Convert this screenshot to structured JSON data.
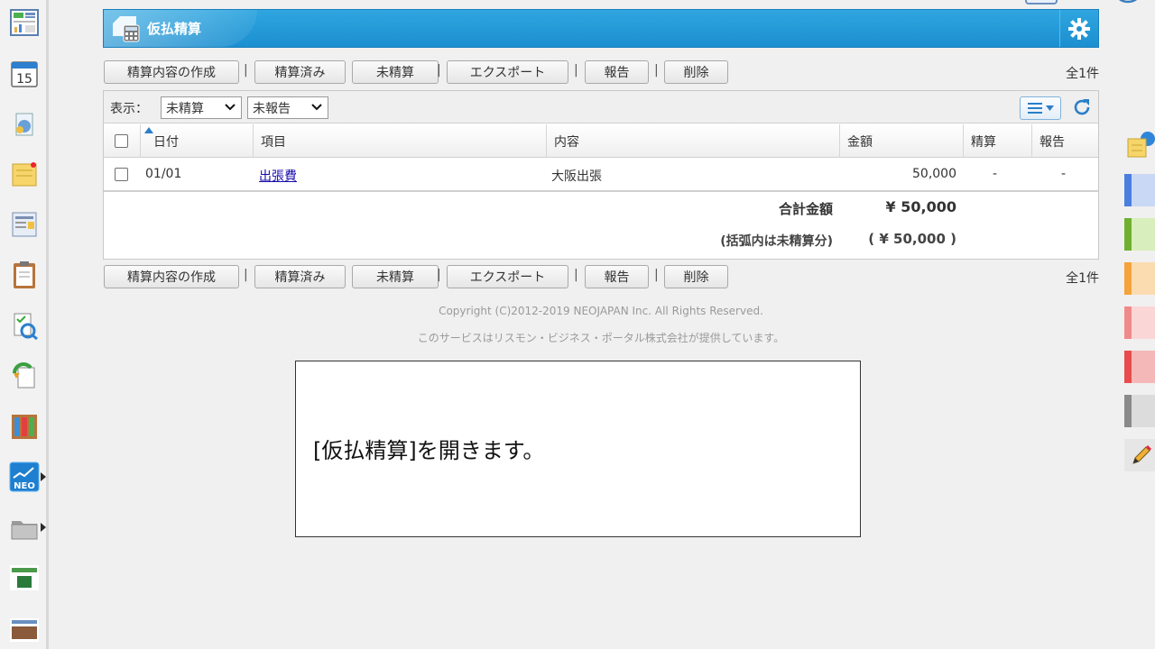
{
  "header": {
    "title": "仮払精算",
    "icons": [
      "calculator-app-icon",
      "gear-icon"
    ]
  },
  "toolbar": {
    "buttons": [
      "精算内容の作成",
      "精算済み",
      "未精算",
      "エクスポート",
      "報告",
      "削除"
    ],
    "separator": "|",
    "count": "全1件"
  },
  "filters": {
    "label": "表示：",
    "status_value": "未精算",
    "report_value": "未報告"
  },
  "table": {
    "columns": [
      "日付",
      "項目",
      "内容",
      "金額",
      "精算",
      "報告"
    ],
    "rows": [
      {
        "date": "01/01",
        "item": "出張費",
        "content": "大阪出張",
        "amount": "50,000",
        "settled": "-",
        "reported": "-"
      }
    ],
    "total_label": "合計金額",
    "total_value": "¥ 50,000",
    "unsettled_label": "(括弧内は未精算分)",
    "unsettled_value": "( ¥ 50,000 )"
  },
  "footer": {
    "copyright": "Copyright (C)2012-2019 NEOJAPAN Inc. All Rights Reserved.",
    "provider": "このサービスはリスモン・ビジネス・ポータル株式会社が提供しています。"
  },
  "caption": "[仮払精算]を開きます。",
  "colors": {
    "header": "#1c8fd0",
    "link": "#1a0dab",
    "right_tabs": [
      "#4a7fe0",
      "#6fb02f",
      "#f5a33a",
      "#f08a8a",
      "#e84c4c",
      "#8a8a8a"
    ]
  }
}
